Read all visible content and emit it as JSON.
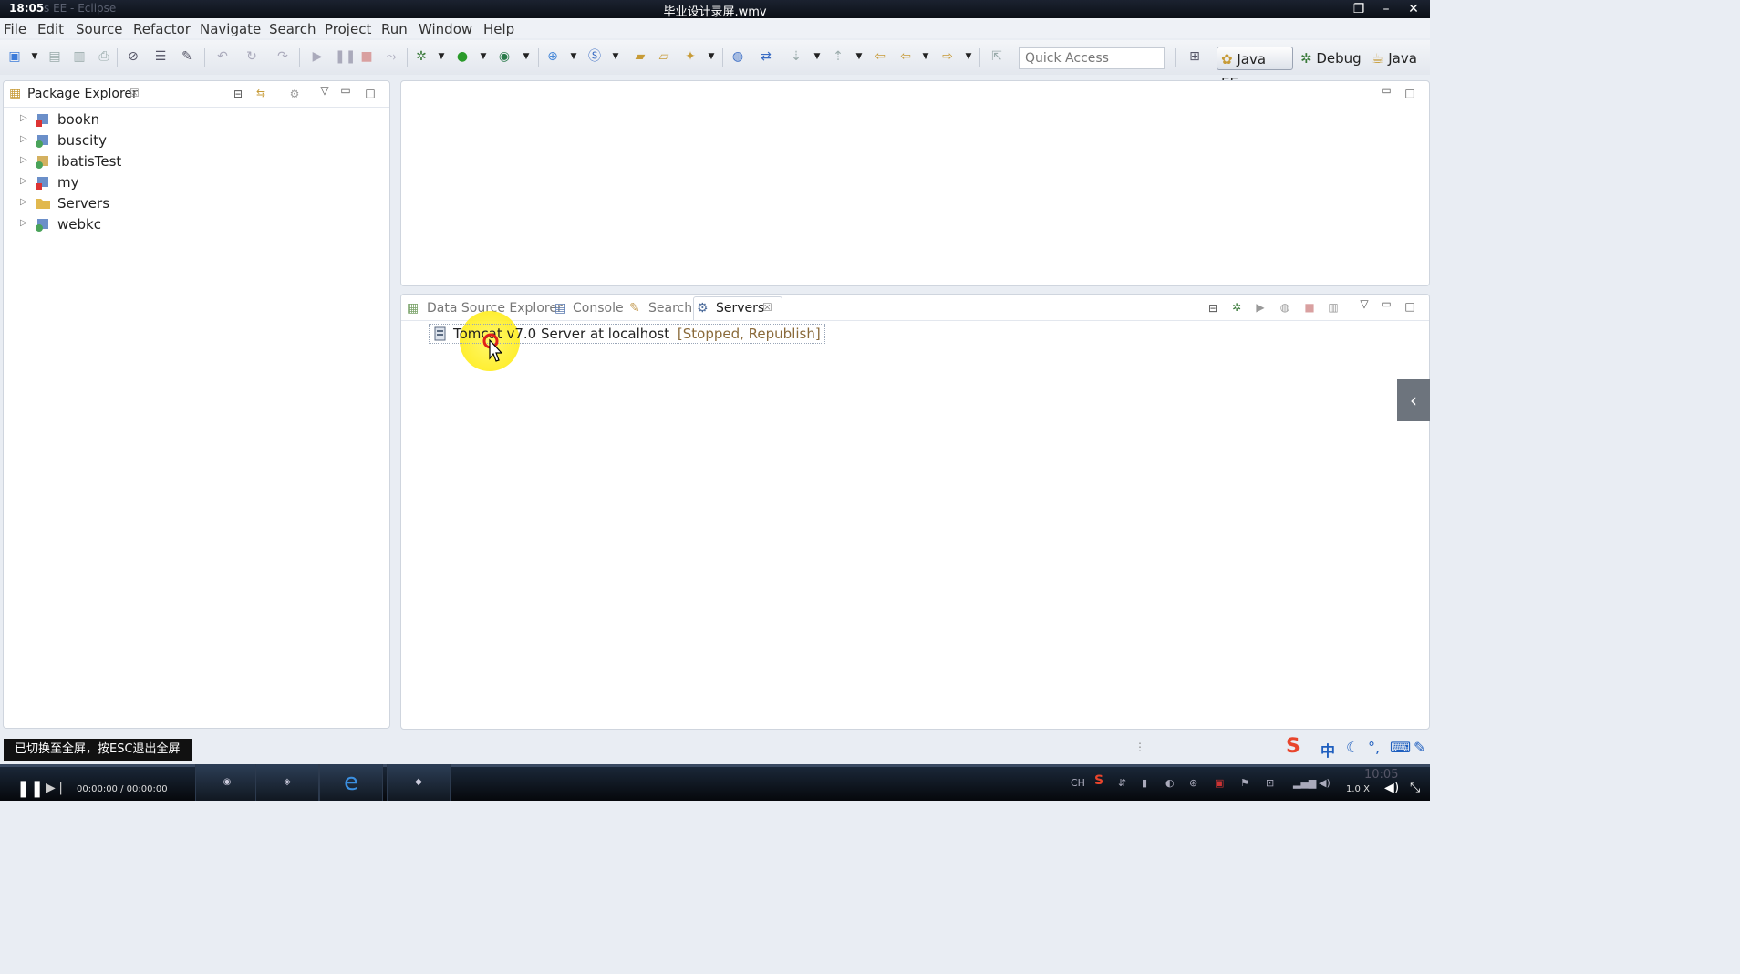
{
  "window": {
    "clock": "18:05",
    "background_app": "s EE - Eclipse",
    "video_title": "毕业设计录屏.wmv"
  },
  "menu": [
    "File",
    "Edit",
    "Source",
    "Refactor",
    "Navigate",
    "Search",
    "Project",
    "Run",
    "Window",
    "Help"
  ],
  "toolbar": {
    "quick_access_placeholder": "Quick Access",
    "perspectives": [
      {
        "label": "Java EE",
        "icon": "javaee-perspective-icon",
        "active": true
      },
      {
        "label": "Debug",
        "icon": "debug-perspective-icon",
        "active": false
      },
      {
        "label": "Java",
        "icon": "java-perspective-icon",
        "active": false
      }
    ]
  },
  "package_explorer": {
    "title": "Package Explorer",
    "projects": [
      {
        "name": "bookn",
        "icon": "project-error-icon"
      },
      {
        "name": "buscity",
        "icon": "web-project-icon"
      },
      {
        "name": "ibatisTest",
        "icon": "web-project-icon"
      },
      {
        "name": "my",
        "icon": "project-error-icon"
      },
      {
        "name": "Servers",
        "icon": "folder-icon"
      },
      {
        "name": "webkc",
        "icon": "web-project-icon"
      }
    ]
  },
  "bottom_tabs": [
    {
      "label": "Data Source Explorer",
      "icon": "database-icon",
      "active": false
    },
    {
      "label": "Console",
      "icon": "console-icon",
      "active": false
    },
    {
      "label": "Search",
      "icon": "search-icon",
      "active": false
    },
    {
      "label": "Servers",
      "icon": "servers-icon",
      "active": true
    }
  ],
  "servers": [
    {
      "name": "Tomcat v7.0 Server at localhost",
      "status": "[Stopped, Republish]"
    }
  ],
  "overlay": {
    "toast": "已切换至全屏，按ESC退出全屏",
    "ime_label": "中"
  },
  "player": {
    "time": "00:00:00 / 00:00:00",
    "speed": "1.0 X",
    "clock": "10:05",
    "lang": "CH",
    "progress": 0.0
  },
  "colors": {
    "accent": "#3a6ea5",
    "highlight": "#ffe800",
    "titlebar": "#0b0f16"
  }
}
